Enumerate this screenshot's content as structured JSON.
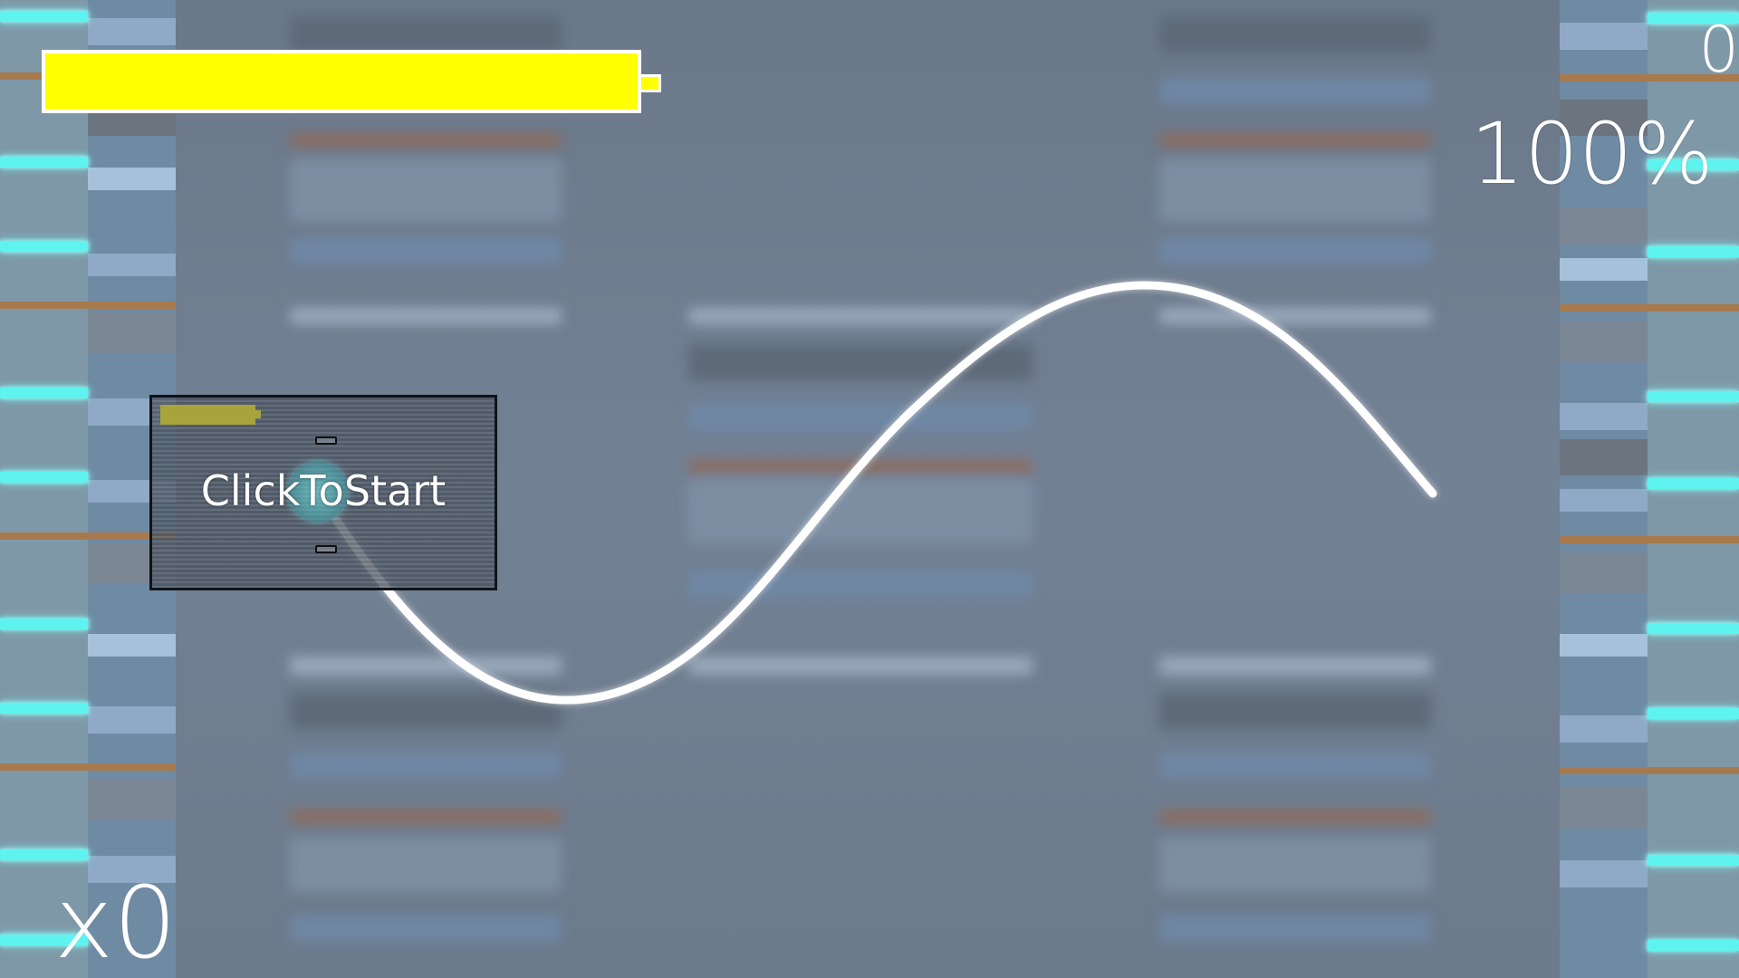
{
  "hud": {
    "score": "0",
    "accuracy": "100%",
    "combo": "x0",
    "health_fraction": 1.0
  },
  "start_panel": {
    "label": "ClickToStart"
  },
  "colors": {
    "health": "#ffff00",
    "key_glow": "#5ef3ee",
    "background": "#6e7c8d",
    "track_line": "#ffffff"
  },
  "icons": {
    "cursor": "cursor-ring-icon"
  }
}
